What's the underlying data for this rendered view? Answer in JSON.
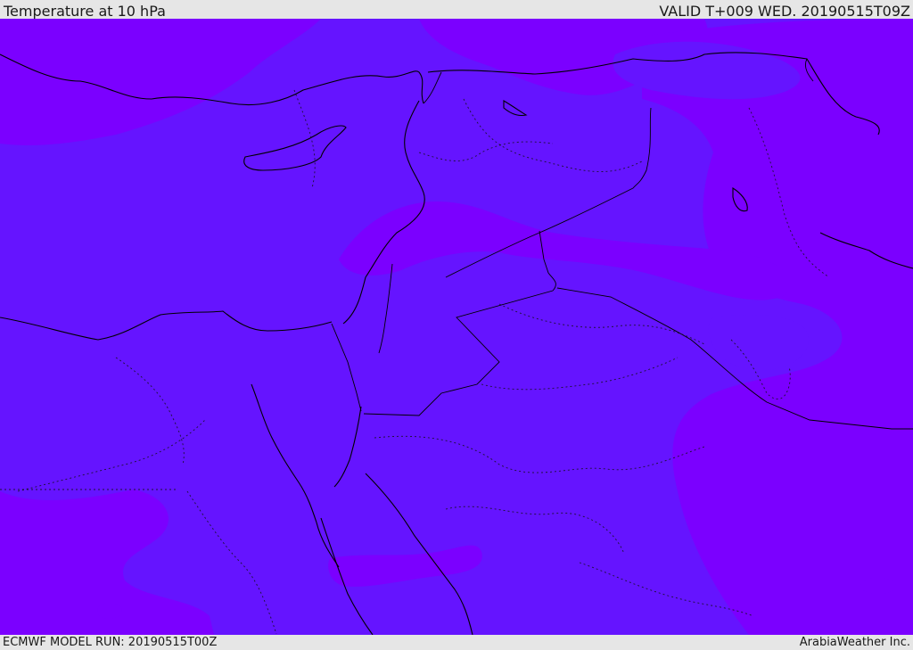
{
  "header": {
    "title": "Temperature at 10 hPa",
    "valid": "VALID T+009 WED. 20190515T09Z"
  },
  "footer": {
    "model_run": "ECMWF MODEL RUN: 20190515T00Z",
    "credit": "ArabiaWeather Inc."
  },
  "map": {
    "base_color": "#6514ff",
    "warm_color": "#7b00ff",
    "line_color": "#000000"
  }
}
